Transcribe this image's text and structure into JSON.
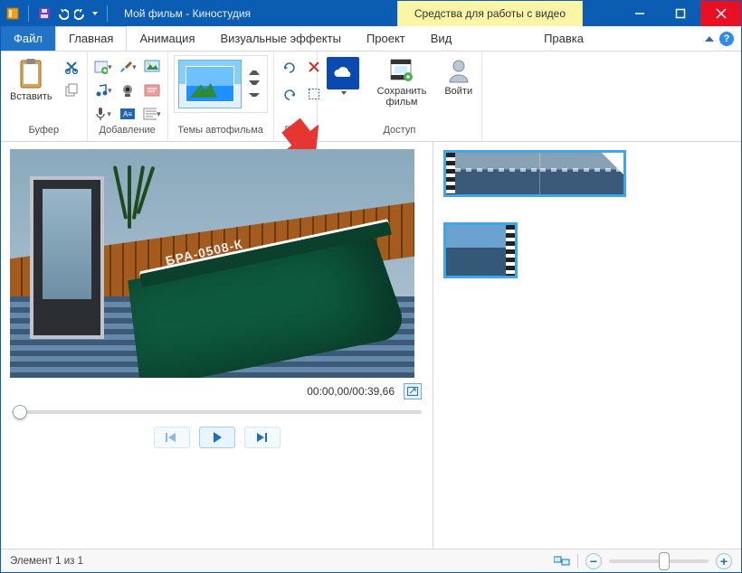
{
  "titlebar": {
    "title": "Мой фильм - Киностудия",
    "context_tab": "Средства для работы с видео"
  },
  "tabs": {
    "file": "Файл",
    "home": "Главная",
    "animation": "Анимация",
    "effects": "Визуальные эффекты",
    "project": "Проект",
    "view": "Вид",
    "edit": "Правка"
  },
  "ribbon": {
    "buffer": {
      "paste": "Вставить",
      "group": "Буфер"
    },
    "add": {
      "group": "Добавление"
    },
    "themes": {
      "group": "Темы автофильма"
    },
    "edit": {
      "group": "Пр..."
    },
    "access": {
      "save": "Сохранить\nфильм",
      "signin": "Войти",
      "group": "Доступ"
    }
  },
  "preview": {
    "boat_registration": "БРА-0508-К",
    "time": "00:00,00/00:39,66"
  },
  "status": {
    "item_text": "Элемент 1 из 1"
  }
}
